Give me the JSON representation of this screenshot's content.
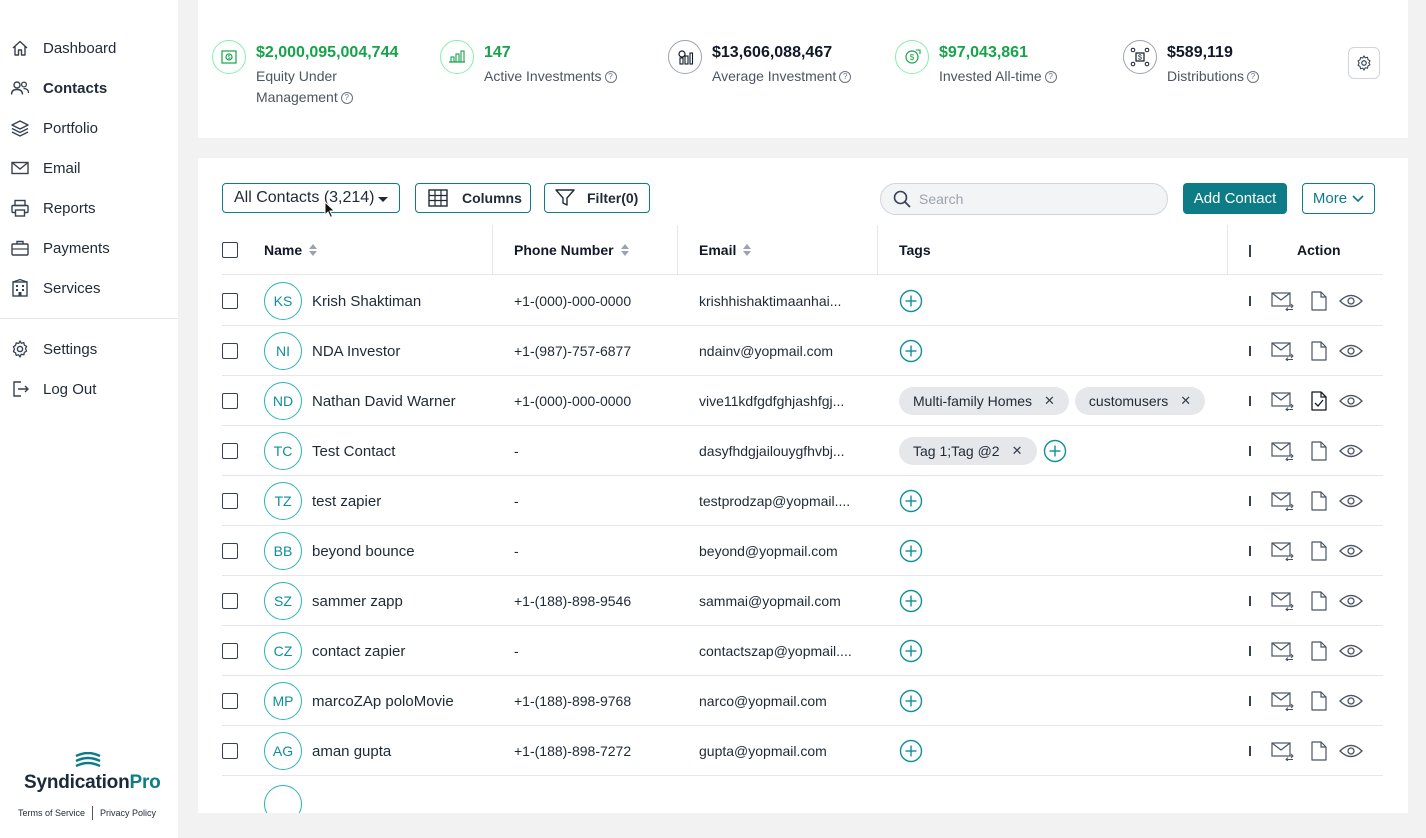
{
  "sidebar": {
    "items": [
      {
        "label": "Dashboard",
        "icon": "home-icon",
        "active": false
      },
      {
        "label": "Contacts",
        "icon": "users-icon",
        "active": true
      },
      {
        "label": "Portfolio",
        "icon": "layers-icon",
        "active": false
      },
      {
        "label": "Email",
        "icon": "mail-icon",
        "active": false
      },
      {
        "label": "Reports",
        "icon": "printer-icon",
        "active": false
      },
      {
        "label": "Payments",
        "icon": "briefcase-icon",
        "active": false
      },
      {
        "label": "Services",
        "icon": "building-icon",
        "active": false
      }
    ],
    "bottom_items": [
      {
        "label": "Settings",
        "icon": "gear-icon"
      },
      {
        "label": "Log Out",
        "icon": "logout-icon"
      }
    ],
    "brand_main": "Syndication",
    "brand_accent": "Pro",
    "terms": "Terms of Service",
    "privacy": "Privacy Policy"
  },
  "stats": [
    {
      "value": "$2,000,095,004,744",
      "caption_line1": "Equity Under",
      "caption_line2": "Management",
      "tone": "green"
    },
    {
      "value": "147",
      "caption_line1": "Active Investments",
      "caption_line2": "",
      "tone": "green"
    },
    {
      "value": "$13,606,088,467",
      "caption_line1": "Average Investment",
      "caption_line2": "",
      "tone": "dark"
    },
    {
      "value": "$97,043,861",
      "caption_line1": "Invested All-time",
      "caption_line2": "",
      "tone": "green"
    },
    {
      "value": "$589,119",
      "caption_line1": "Distributions",
      "caption_line2": "",
      "tone": "dark"
    }
  ],
  "toolbar": {
    "all_contacts": "All Contacts (3,214)",
    "columns": "Columns",
    "filter": "Filter(0)",
    "search_placeholder": "Search",
    "add_contact": "Add Contact",
    "more": "More"
  },
  "table": {
    "headers": {
      "name": "Name",
      "phone": "Phone Number",
      "email": "Email",
      "tags": "Tags",
      "action": "Action"
    },
    "rows": [
      {
        "initials": "KS",
        "name": "Krish Shaktiman",
        "phone": "+1-(000)-000-0000",
        "email": "krishhishaktimaanhai...",
        "tags": [],
        "doc_checked": false
      },
      {
        "initials": "NI",
        "name": "NDA Investor",
        "phone": "+1-(987)-757-6877",
        "email": "ndainv@yopmail.com",
        "tags": [],
        "doc_checked": false
      },
      {
        "initials": "ND",
        "name": "Nathan David Warner",
        "phone": "+1-(000)-000-0000",
        "email": "vive11kdfgdfghjashfgj...",
        "tags": [
          "Multi-family Homes",
          "customusers"
        ],
        "doc_checked": true
      },
      {
        "initials": "TC",
        "name": "Test Contact",
        "phone": "-",
        "email": "dasyfhdgjailouygfhvbj...",
        "tags": [
          "Tag 1;Tag @2"
        ],
        "doc_checked": false
      },
      {
        "initials": "TZ",
        "name": "test zapier",
        "phone": "-",
        "email": "testprodzap@yopmail....",
        "tags": [],
        "doc_checked": false
      },
      {
        "initials": "BB",
        "name": "beyond bounce",
        "phone": "-",
        "email": "beyond@yopmail.com",
        "tags": [],
        "doc_checked": false
      },
      {
        "initials": "SZ",
        "name": "sammer zapp",
        "phone": "+1-(188)-898-9546",
        "email": "sammai@yopmail.com",
        "tags": [],
        "doc_checked": false
      },
      {
        "initials": "CZ",
        "name": "contact zapier",
        "phone": "-",
        "email": "contactszap@yopmail....",
        "tags": [],
        "doc_checked": false
      },
      {
        "initials": "MP",
        "name": "marcoZAp poloMovie",
        "phone": "+1-(188)-898-9768",
        "email": "narco@yopmail.com",
        "tags": [],
        "doc_checked": false
      },
      {
        "initials": "AG",
        "name": "aman gupta",
        "phone": "+1-(188)-898-7272",
        "email": "gupta@yopmail.com",
        "tags": [],
        "doc_checked": false
      }
    ]
  },
  "colors": {
    "accent": "#0e7c86",
    "positive": "#16a34a"
  }
}
